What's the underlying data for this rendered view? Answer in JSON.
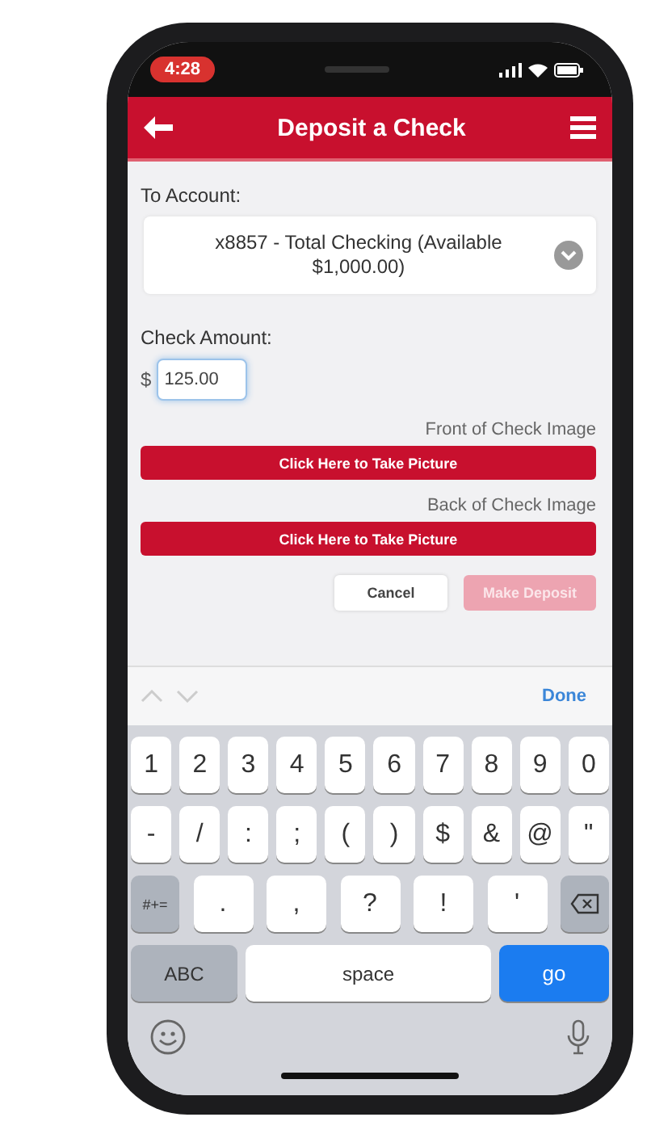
{
  "status_bar": {
    "time": "4:28"
  },
  "header": {
    "title": "Deposit a Check"
  },
  "account": {
    "label": "To Account:",
    "value": "x8857 - Total Checking (Available $1,000.00)"
  },
  "amount": {
    "label": "Check Amount:",
    "currency": "$",
    "value": "125.00"
  },
  "images": [
    {
      "label": "Front of Check Image",
      "button": "Click Here to Take Picture"
    },
    {
      "label": "Back of Check Image",
      "button": "Click Here to Take Picture"
    }
  ],
  "actions": [
    {
      "label": "Cancel",
      "kind": "secondary",
      "disabled": false
    },
    {
      "label": "Make Deposit",
      "kind": "primary",
      "disabled": true
    }
  ],
  "keyboard": {
    "done": "Done",
    "number_keys": [
      {
        "label": "1",
        "kind": "char"
      },
      {
        "label": "2",
        "kind": "char"
      },
      {
        "label": "3",
        "kind": "char"
      },
      {
        "label": "4",
        "kind": "char"
      },
      {
        "label": "5",
        "kind": "char"
      },
      {
        "label": "6",
        "kind": "char"
      },
      {
        "label": "7",
        "kind": "char"
      },
      {
        "label": "8",
        "kind": "char"
      },
      {
        "label": "9",
        "kind": "char"
      },
      {
        "label": "0",
        "kind": "char"
      }
    ],
    "symbol_keys": [
      {
        "label": "-",
        "kind": "char"
      },
      {
        "label": "/",
        "kind": "char"
      },
      {
        "label": ":",
        "kind": "char"
      },
      {
        "label": ";",
        "kind": "char"
      },
      {
        "label": "(",
        "kind": "char"
      },
      {
        "label": ")",
        "kind": "char"
      },
      {
        "label": "$",
        "kind": "char"
      },
      {
        "label": "&",
        "kind": "char"
      },
      {
        "label": "@",
        "kind": "char"
      },
      {
        "label": "\"",
        "kind": "char"
      }
    ],
    "punctuation_keys": [
      {
        "label": "#+=",
        "kind": "mode"
      },
      {
        "label": ".",
        "kind": "punct"
      },
      {
        "label": ",",
        "kind": "punct"
      },
      {
        "label": "?",
        "kind": "punct"
      },
      {
        "label": "!",
        "kind": "punct"
      },
      {
        "label": "'",
        "kind": "punct"
      },
      {
        "kind": "delete"
      }
    ],
    "bottom_keys": [
      {
        "label": "ABC",
        "kind": "mode-wide"
      },
      {
        "label": "space",
        "kind": "space"
      },
      {
        "label": "go",
        "kind": "go"
      }
    ]
  }
}
